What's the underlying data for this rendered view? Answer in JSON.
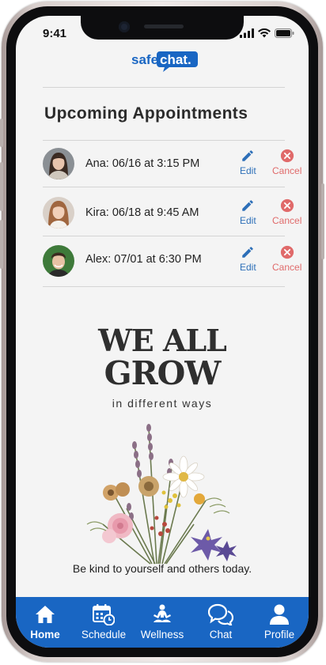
{
  "status_bar": {
    "time": "9:41"
  },
  "logo": {
    "text_left": "safe",
    "text_right": "chat."
  },
  "section": {
    "title": "Upcoming Appointments"
  },
  "appointments": [
    {
      "text": "Ana: 06/16 at 3:15 PM",
      "edit_label": "Edit",
      "cancel_label": "Cancel"
    },
    {
      "text": "Kira: 06/18 at 9:45 AM",
      "edit_label": "Edit",
      "cancel_label": "Cancel"
    },
    {
      "text": "Alex: 07/01 at 6:30 PM",
      "edit_label": "Edit",
      "cancel_label": "Cancel"
    }
  ],
  "poster": {
    "line1": "WE ALL",
    "line2": "GROW",
    "line3": "in different ways",
    "caption": "Be kind to yourself and others today."
  },
  "tabs": [
    {
      "label": "Home",
      "icon": "home-icon",
      "active": true
    },
    {
      "label": "Schedule",
      "icon": "calendar-icon",
      "active": false
    },
    {
      "label": "Wellness",
      "icon": "meditation-icon",
      "active": false
    },
    {
      "label": "Chat",
      "icon": "chat-bubbles-icon",
      "active": false
    },
    {
      "label": "Profile",
      "icon": "person-icon",
      "active": false
    }
  ],
  "colors": {
    "primary_blue": "#1966c3",
    "edit_blue": "#2d6fb8",
    "cancel_red": "#e06a6a",
    "screen_bg": "#f4f4f4"
  }
}
